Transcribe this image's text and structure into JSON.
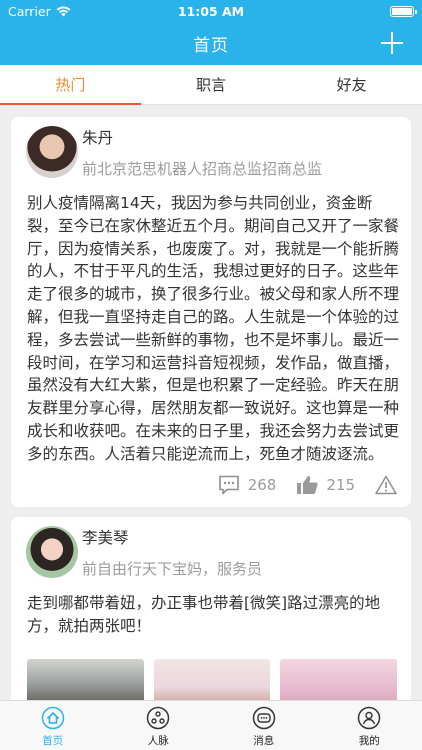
{
  "status_bar": {
    "carrier": "Carrier",
    "time": "11:05 AM"
  },
  "nav": {
    "title": "首页"
  },
  "tabs": [
    {
      "label": "热门"
    },
    {
      "label": "职言"
    },
    {
      "label": "好友"
    }
  ],
  "posts": [
    {
      "name": "朱丹",
      "description": "前北京范思机器人招商总监招商总监",
      "content": "别人疫情隔离14天，我因为参与共同创业，资金断裂，至今已在家休整近五个月。期间自己又开了一家餐厅，因为疫情关系，也废废了。对，我就是一个能折腾的人，不甘于平凡的生活，我想过更好的日子。这些年走了很多的城市，换了很多行业。被父母和家人所不理解，但我一直坚持走自己的路。人生就是一个体验的过程，多去尝试一些新鲜的事物，也不是坏事儿。最近一段时间，在学习和运营抖音短视频，发作品，做直播，虽然没有大红大紫，但是也积累了一定经验。昨天在朋友群里分享心得，居然朋友都一致说好。这也算是一种成长和收获吧。在未来的日子里，我还会努力去尝试更多的东西。人活着只能逆流而上，死鱼才随波逐流。",
      "comments": "268",
      "likes": "215"
    },
    {
      "name": "李美琴",
      "description": "前自由行天下宝妈，服务员",
      "content": "走到哪都带着妞，办正事也带着[微笑]路过漂亮的地方，就拍两张吧！"
    }
  ],
  "tabbar": [
    {
      "label": "首页",
      "icon": "home-icon"
    },
    {
      "label": "人脉",
      "icon": "network-icon"
    },
    {
      "label": "消息",
      "icon": "message-icon"
    },
    {
      "label": "我的",
      "icon": "profile-icon"
    }
  ],
  "colors": {
    "primary": "#29b3ea",
    "tab_active": "#f08c2e",
    "tab_indicator": "#e85b2e"
  }
}
